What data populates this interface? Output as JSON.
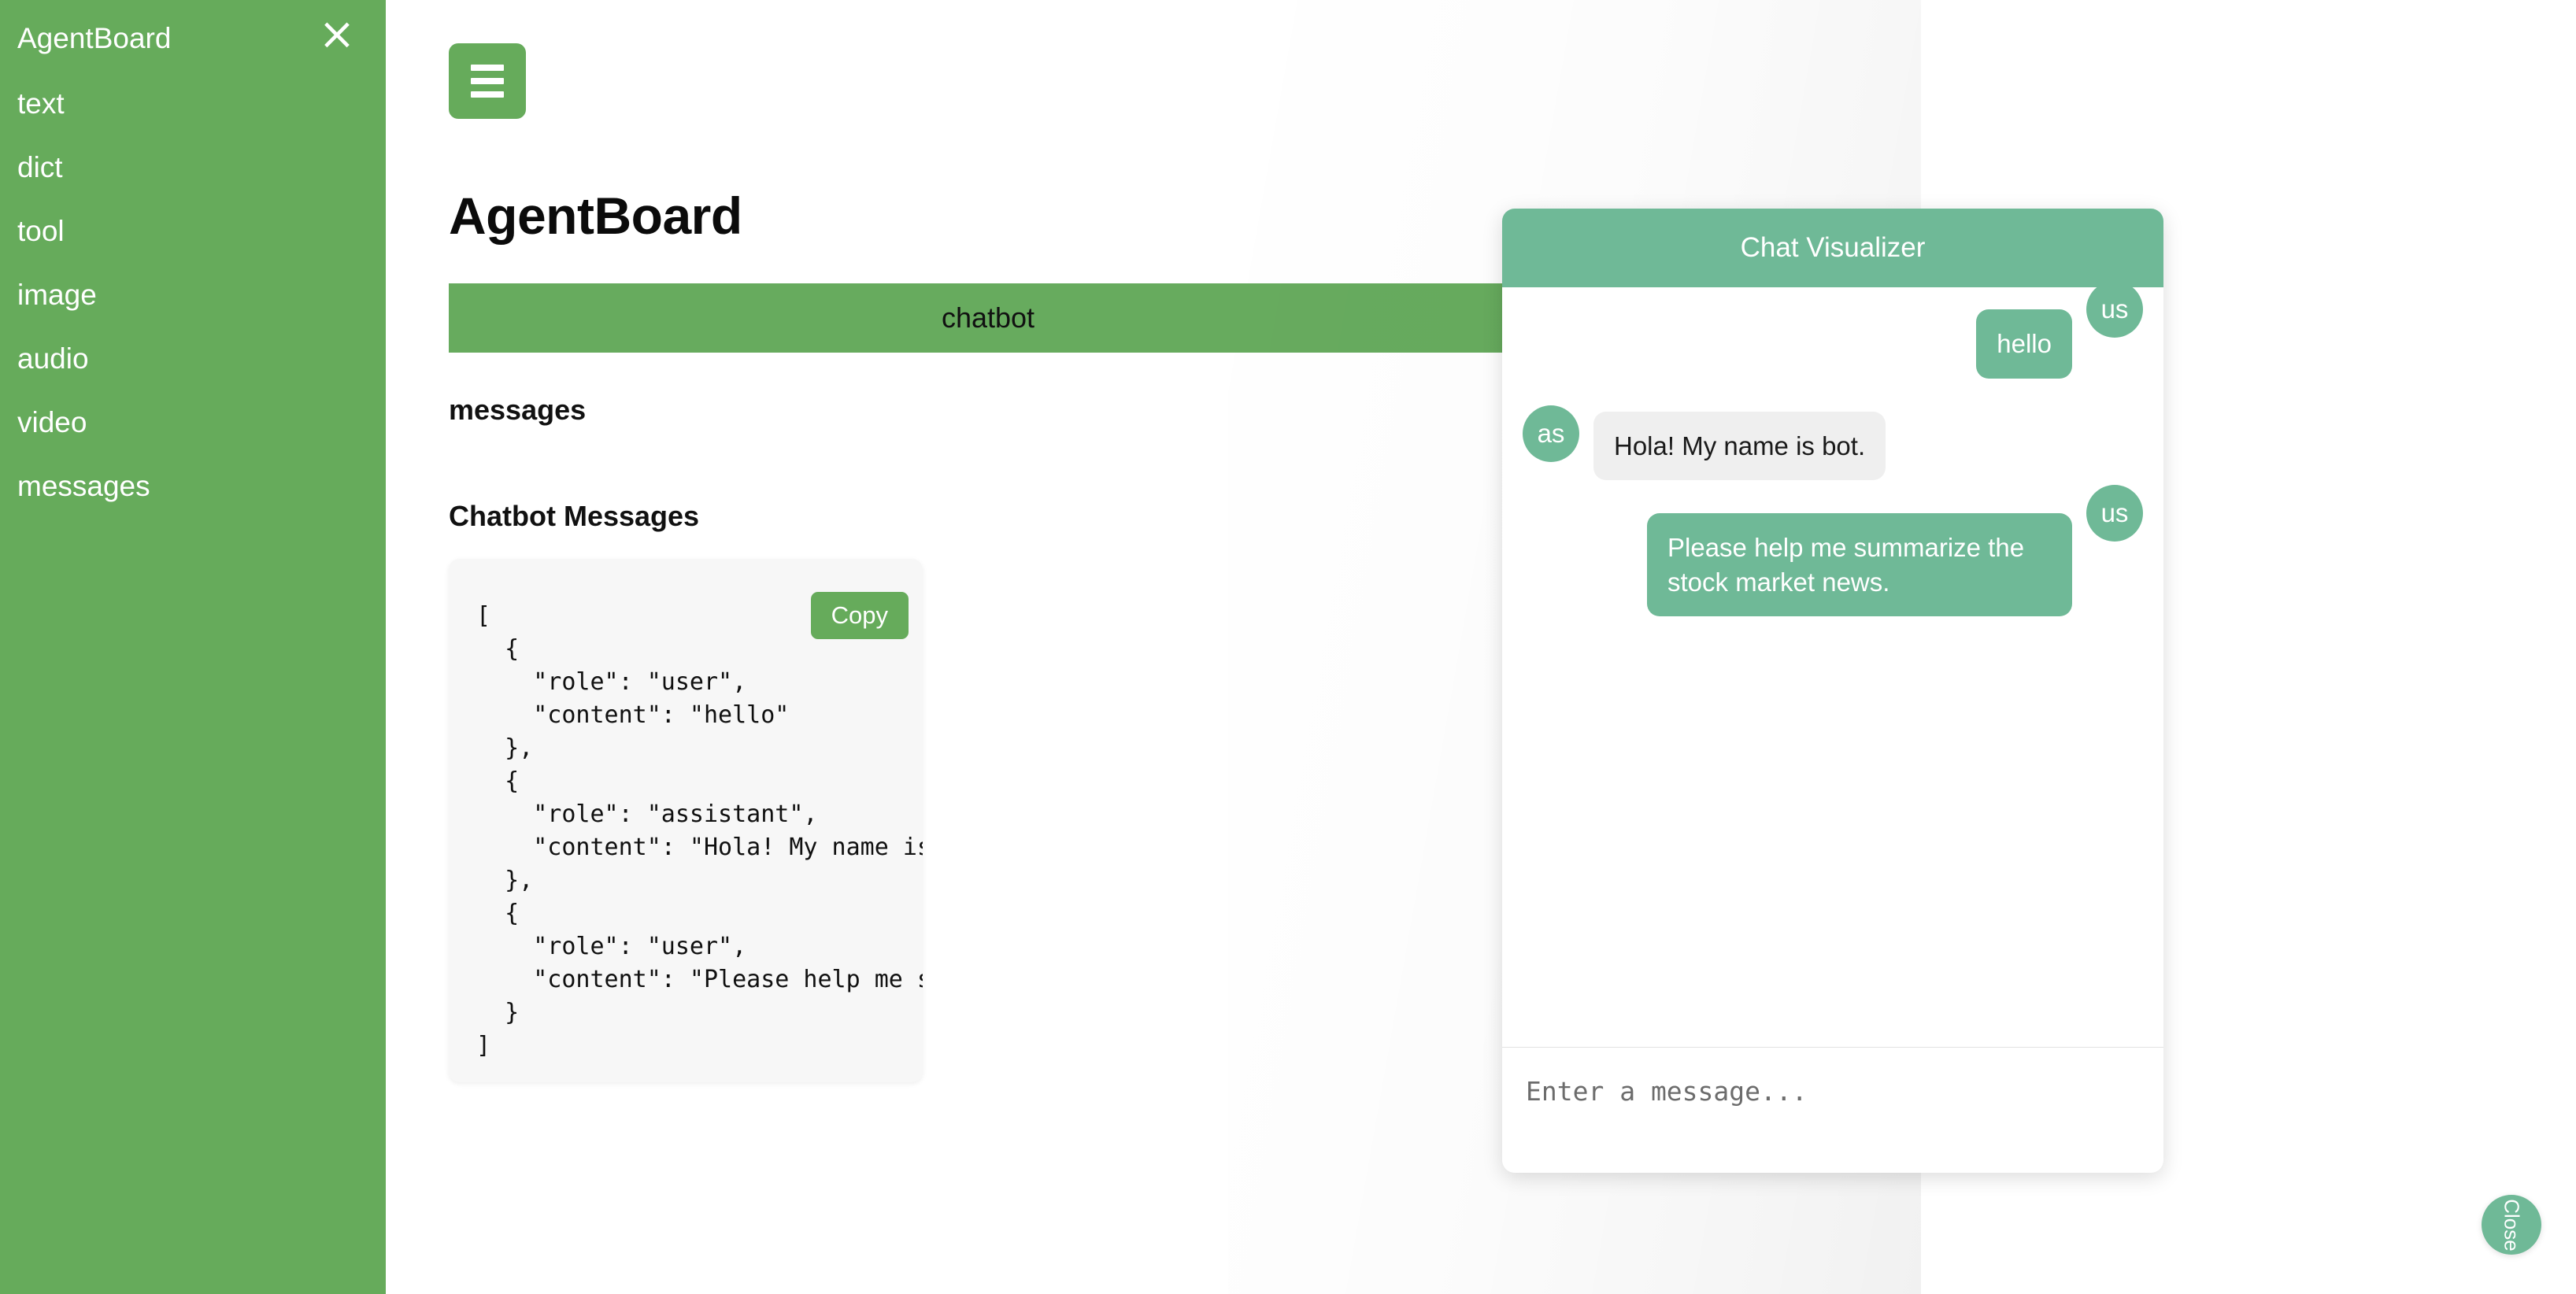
{
  "sidebar": {
    "brand": "AgentBoard",
    "close_icon": "×",
    "items": [
      {
        "label": "text"
      },
      {
        "label": "dict"
      },
      {
        "label": "tool"
      },
      {
        "label": "image"
      },
      {
        "label": "audio"
      },
      {
        "label": "video"
      },
      {
        "label": "messages"
      }
    ]
  },
  "main": {
    "menu_button_icon": "hamburger-icon",
    "title": "AgentBoard",
    "tabs": [
      {
        "label": "chatbot",
        "active": true
      }
    ],
    "section_label": "messages",
    "block_heading": "Chatbot Messages",
    "code_block": {
      "copy_label": "Copy",
      "content": "[\n  {\n    \"role\": \"user\",\n    \"content\": \"hello\"\n  },\n  {\n    \"role\": \"assistant\",\n    \"content\": \"Hola! My name is\n  },\n  {\n    \"role\": \"user\",\n    \"content\": \"Please help me s\n  }\n]"
    }
  },
  "chat_panel": {
    "header_title": "Chat Visualizer",
    "messages": [
      {
        "role": "user",
        "avatar": "us",
        "text": "hello"
      },
      {
        "role": "assistant",
        "avatar": "as",
        "text": "Hola! My name is bot."
      },
      {
        "role": "user",
        "avatar": "us",
        "text": "Please help me summarize the stock market news."
      }
    ],
    "input_placeholder": "Enter a message...",
    "input_value": "",
    "close_label": "Close"
  },
  "colors": {
    "sidebar_green": "#66ab5b",
    "tab_green": "#67ab5e",
    "chat_teal": "#6fb997",
    "assistant_bubble_grey": "#efefef",
    "code_bg": "#f7f7f7"
  }
}
